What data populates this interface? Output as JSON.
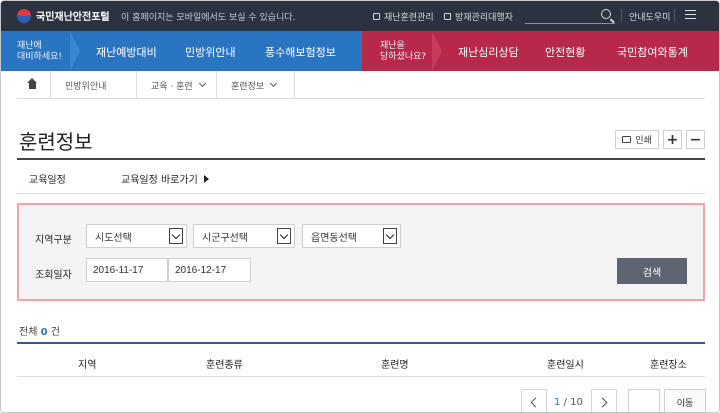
{
  "topbar": {
    "logo": "국민재난안전포털",
    "notice": "이 홈페이지는 모바일에서도 보실 수 있습니다.",
    "links": [
      "재난훈련관리",
      "방재관리대행자"
    ],
    "search_placeholder": "",
    "help": "안내도우미"
  },
  "nav": {
    "left_intro": [
      "재난에",
      "대비하세요!"
    ],
    "left_items": [
      "재난예방대비",
      "민방위안내",
      "풍수해보험정보"
    ],
    "right_intro": [
      "재난을",
      "당하셨나요?"
    ],
    "right_items": [
      "재난심리상담",
      "안전현황",
      "국민참여와통계"
    ],
    "colors": {
      "left": "#2a75c2",
      "right": "#b8284a"
    }
  },
  "breadcrumb": [
    "민방위안내",
    "교육 · 훈련",
    "훈련정보"
  ],
  "page": {
    "title": "훈련정보",
    "print": "인쇄",
    "zoom_in": "+",
    "zoom_out": "−"
  },
  "tabs": [
    "교육일정",
    "교육일정 바로가기"
  ],
  "search": {
    "region_label": "지역구분",
    "region_selects": [
      "시도선택",
      "시군구선택",
      "읍면동선택"
    ],
    "date_label": "조회일자",
    "date_from": "2016-11-17",
    "date_to": "2016-12-17",
    "button": "검색"
  },
  "results": {
    "total_prefix": "전체",
    "total_count": "0",
    "total_suffix": "건",
    "columns": [
      "지역",
      "훈련종류",
      "훈련명",
      "훈련일시",
      "훈련장소"
    ]
  },
  "pagination": {
    "current": "1",
    "total": "/ 10",
    "move": "이동"
  }
}
